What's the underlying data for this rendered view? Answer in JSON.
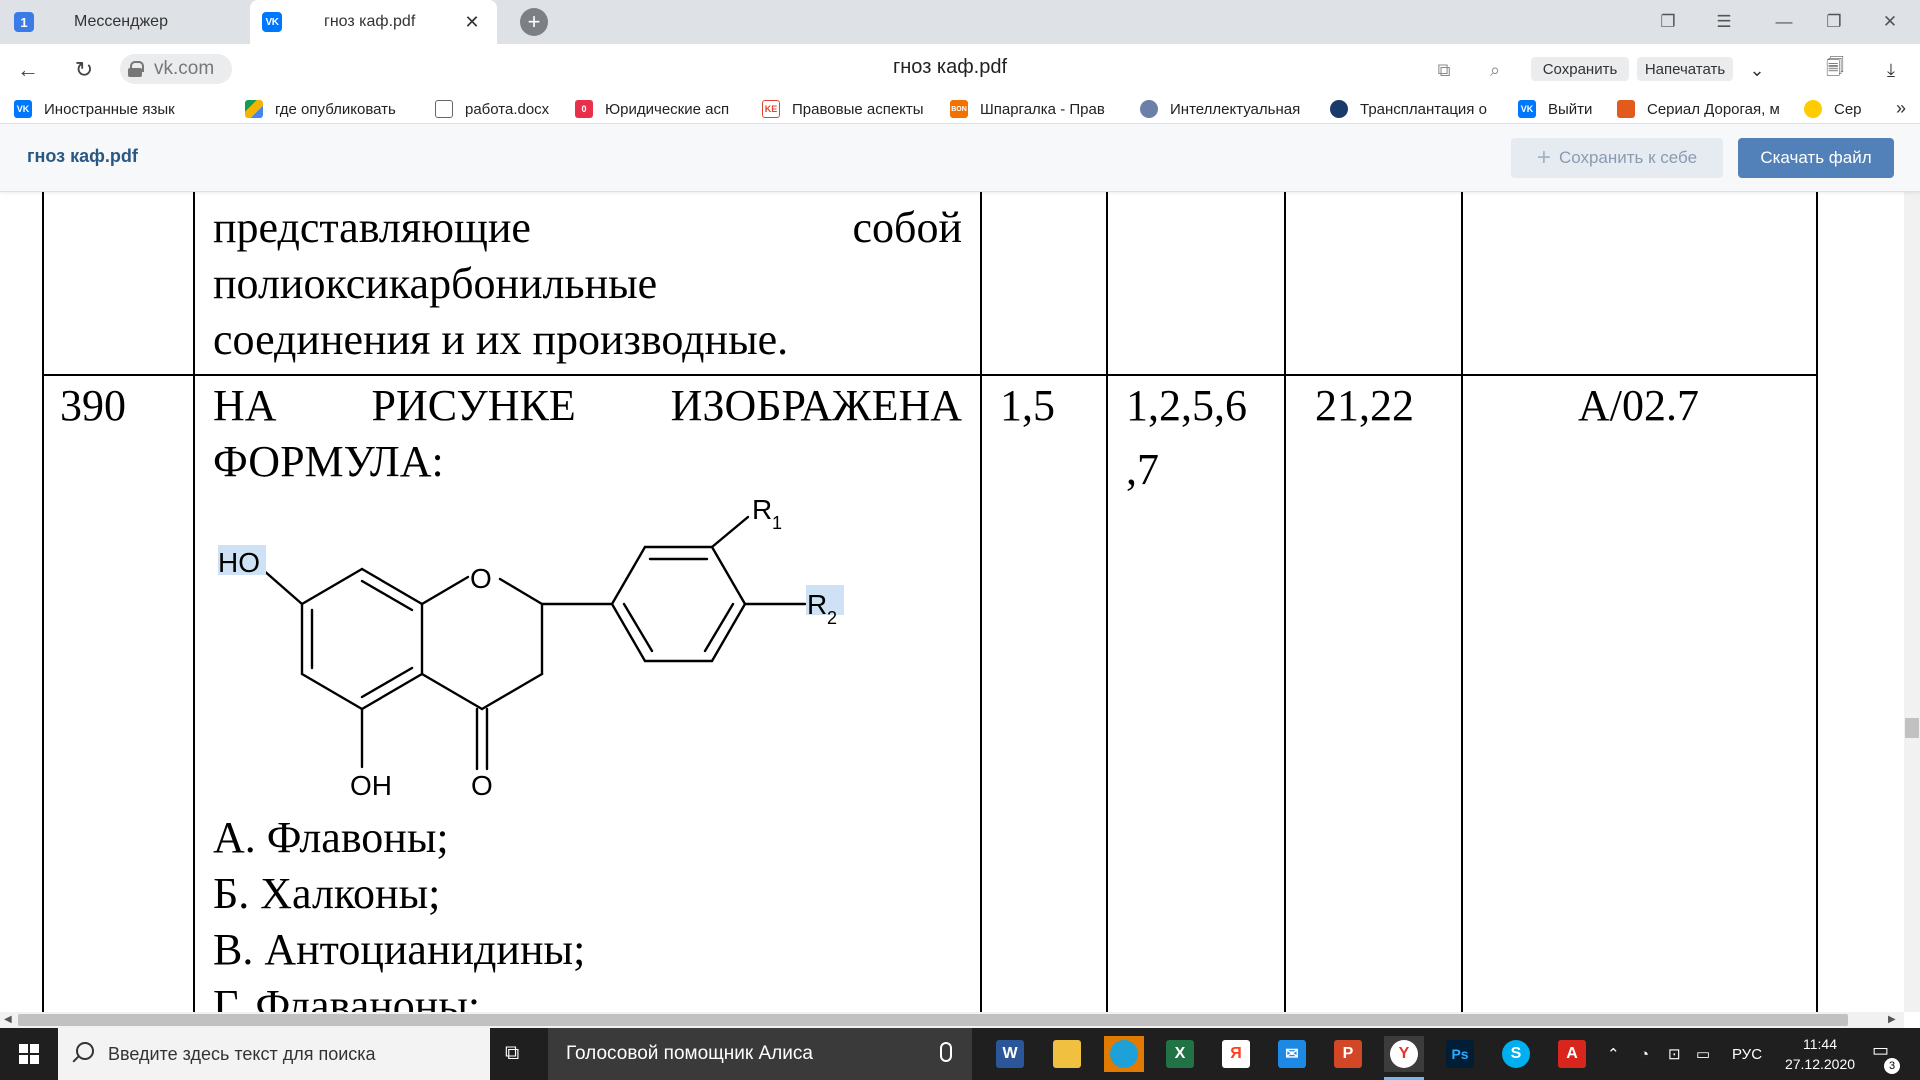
{
  "tabs": [
    {
      "badge": "1",
      "label": "Мессенджер"
    },
    {
      "label": "гноз каф.pdf",
      "close": "✕"
    }
  ],
  "address": {
    "url": "vk.com",
    "page_title": "гноз каф.pdf",
    "save_label": "Сохранить",
    "print_label": "Напечатать"
  },
  "bookmarks": [
    {
      "label": "Иностранные язык",
      "icon": "vk-icon",
      "color": "#0077ff"
    },
    {
      "label": "где опубликовать",
      "icon": "drive-icon",
      "color": "#f4b400"
    },
    {
      "label": "работа.docx",
      "icon": "document-icon",
      "color": "#ffffff"
    },
    {
      "label": "Юридические асп",
      "icon": "bookmark-red-icon",
      "color": "#e8304a"
    },
    {
      "label": "Правовые аспекты",
      "icon": "ke-icon",
      "color": "#e0452c"
    },
    {
      "label": "Шпаргалка - Прав",
      "icon": "bonus-icon",
      "color": "#f27200"
    },
    {
      "label": "Интеллектуальная",
      "icon": "globe-icon",
      "color": "#6b7fa8"
    },
    {
      "label": "Трансплантация о",
      "icon": "moon-icon",
      "color": "#1a3a6b"
    },
    {
      "label": "Выйти",
      "icon": "vk-icon",
      "color": "#0077ff"
    },
    {
      "label": "Сериал Дорогая, м",
      "icon": "fox-icon",
      "color": "#e25a1c"
    },
    {
      "label": "Сер",
      "icon": "yandex-icon",
      "color": "#ffcc00"
    }
  ],
  "doc_header": {
    "title": "гноз каф.pdf",
    "save_to_me": "Сохранить к себе",
    "download": "Скачать файл"
  },
  "document": {
    "prev_row_lines": [
      "представляющие",
      "собой",
      "полиоксикарбонильные",
      "соединения и их производные."
    ],
    "row_number": "390",
    "question_words": [
      "НА",
      "РИСУНКЕ",
      "ИЗОБРАЖЕНА"
    ],
    "question_line2": "ФОРМУЛА:",
    "col3": "1,5",
    "col4_line1": "1,2,5,6",
    "col4_line2": ",7",
    "col5": "21,22",
    "col6": "А/02.7",
    "answers": [
      "А. Флавоны;",
      "Б. Халконы;",
      "В. Антоцианидины;",
      "Г. Флаваноны;"
    ],
    "formula_labels": {
      "r1": "R",
      "r1_sub": "1",
      "r2": "R",
      "r2_sub": "2",
      "ho": "HO",
      "o_ring": "O",
      "oh": "OH",
      "o_keto": "O"
    }
  },
  "taskbar": {
    "search_placeholder": "Введите здесь текст для поиска",
    "alice": "Голосовой помощник Алиса",
    "lang": "РУС",
    "time": "11:44",
    "date": "27.12.2020",
    "notifications": "3"
  }
}
